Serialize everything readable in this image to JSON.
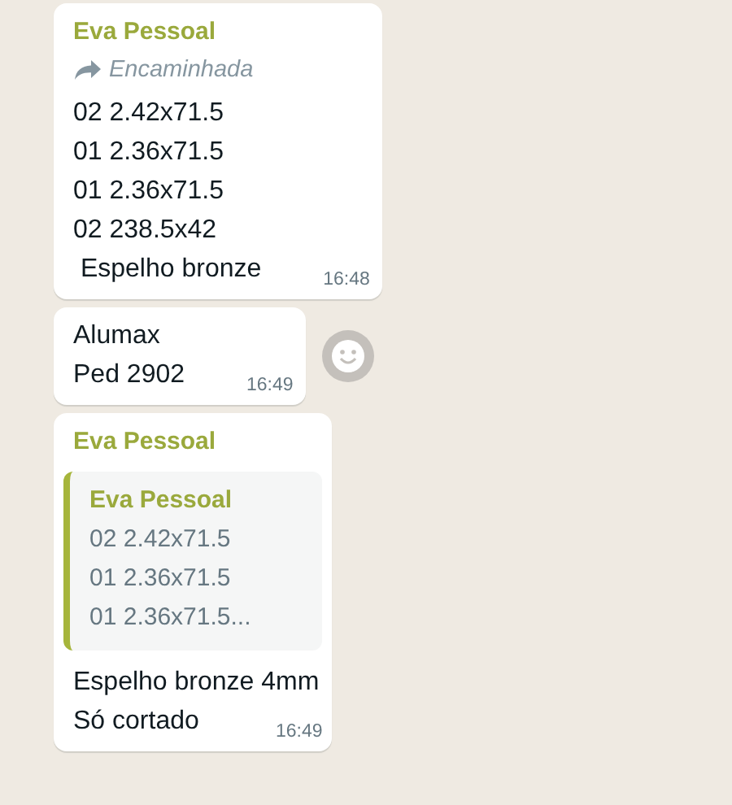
{
  "messages": [
    {
      "sender": "Eva Pessoal",
      "forwarded": "Encaminhada",
      "text": "02 2.42x71.5\n01 2.36x71.5\n01 2.36x71.5\n02 238.5x42\n Espelho bronze",
      "time": "16:48",
      "reaction_button": false
    },
    {
      "text": "Alumax\nPed 2902",
      "time": "16:49",
      "reaction_button": true
    },
    {
      "sender": "Eva Pessoal",
      "quote": {
        "sender": "Eva Pessoal",
        "text": "02 2.42x71.5\n01 2.36x71.5\n01 2.36x71.5..."
      },
      "text": "Espelho bronze 4mm\nSó cortado",
      "time": "16:49",
      "reaction_button": false
    }
  ]
}
